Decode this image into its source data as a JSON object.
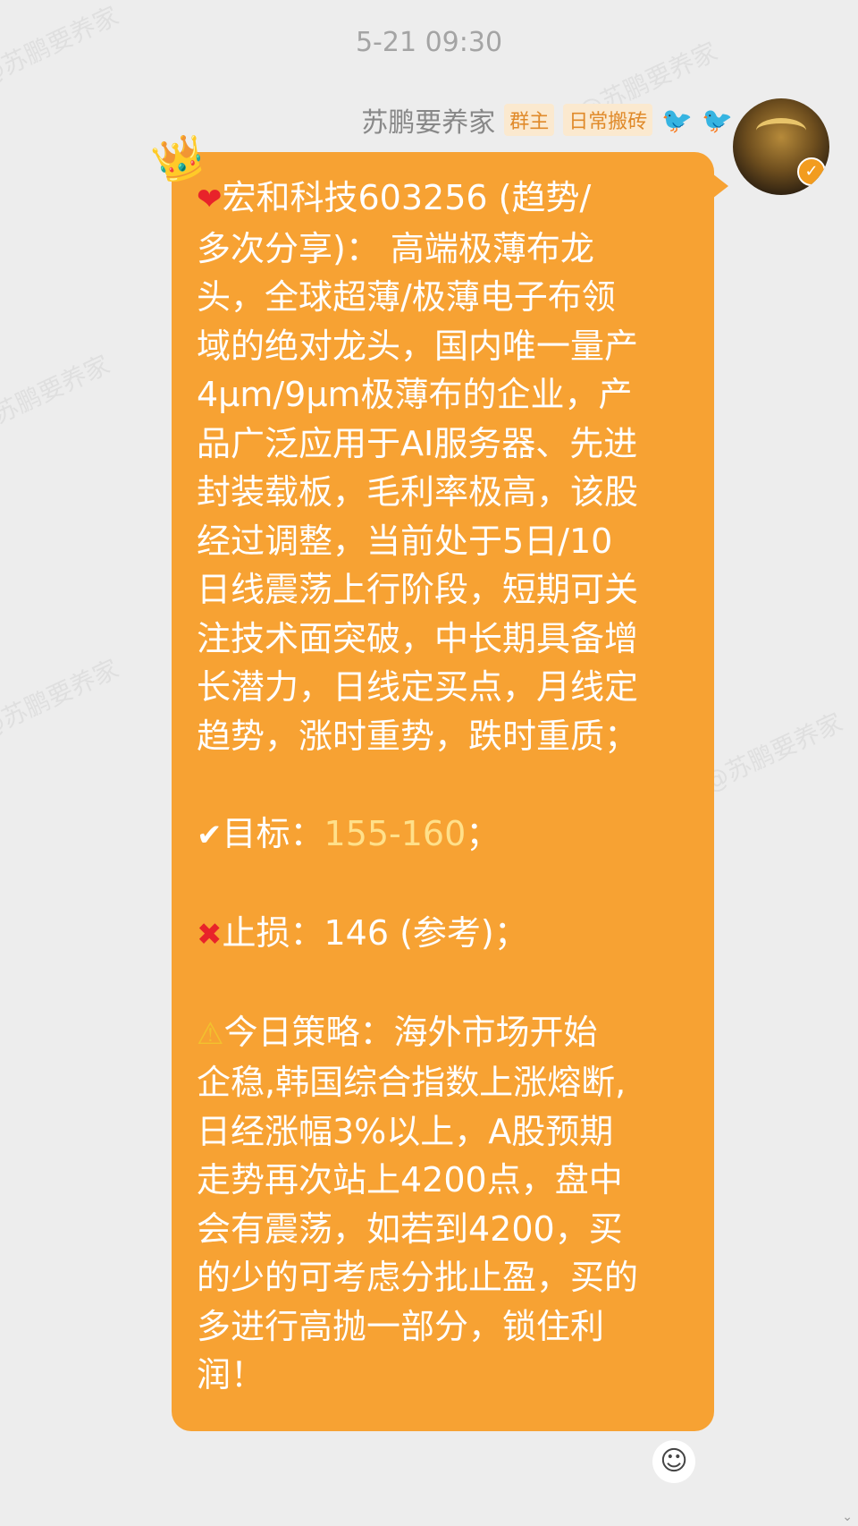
{
  "watermark": "@苏鹏要养家",
  "timestamp": "5-21 09:30",
  "sender": {
    "name": "苏鹏要养家",
    "badges": [
      "群主",
      "日常搬砖"
    ],
    "verified_icon": "v-badge-icon"
  },
  "message": {
    "lines_intro": [
      "宏和科技603256 (趋势/",
      "多次分享)： 高端极薄布龙",
      "头，全球超薄/极薄电子布领",
      "域的绝对龙头，国内唯一量产",
      "4μm/9μm极薄布的企业，产",
      "品广泛应用于AI服务器、先进",
      "封装载板，毛利率极高，该股",
      "经过调整，当前处于5日/10",
      "日线震荡上行阶段，短期可关",
      "注技术面突破，中长期具备增",
      "长潜力，日线定买点，月线定",
      "趋势，涨时重势，跌时重质；"
    ],
    "target_label": "目标：",
    "target_value": "155-160",
    "target_end": "；",
    "stop_label": "止损：146 (参考)；",
    "strategy_lines": [
      "今日策略：海外市场开始",
      "企稳,韩国综合指数上涨熔断,",
      "日经涨幅3%以上，A股预期",
      "走势再次站上4200点，盘中",
      "会有震荡，如若到4200，买",
      "的少的可考虑分批止盈，买的",
      "多进行高抛一部分，锁住利",
      "润！"
    ]
  },
  "colors": {
    "bubble": "#f7a233",
    "background": "#ededed",
    "target_value": "#ffe08a"
  },
  "icons": {
    "heart": "heart-icon",
    "check": "check-mark-icon",
    "cross": "cross-mark-icon",
    "warning": "warning-icon",
    "crown": "crown-icon",
    "add_reaction": "add-reaction-icon"
  }
}
